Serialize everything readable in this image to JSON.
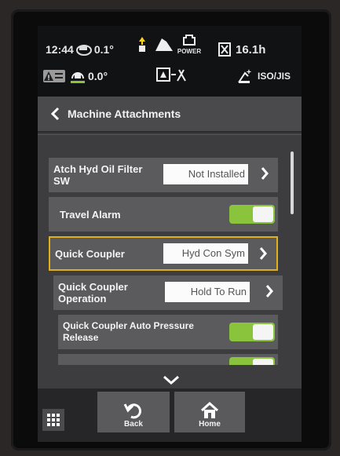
{
  "status": {
    "time": "12:44",
    "pitch": "0.1°",
    "roll": "0.0°",
    "power_label": "POWER",
    "hours": "16.1h",
    "pattern": "ISO/JIS"
  },
  "header": {
    "title": "Machine Attachments"
  },
  "settings": [
    {
      "label": "Atch Hyd Oil Filter SW",
      "value": "Not Installed"
    },
    {
      "label": "Travel Alarm"
    },
    {
      "label": "Quick Coupler",
      "value": "Hyd Con Sym"
    },
    {
      "label": "Quick Coupler Operation",
      "value": "Hold To Run"
    },
    {
      "label": "Quick Coupler Auto Pressure Release"
    }
  ],
  "footer": {
    "back_label": "Back",
    "home_label": "Home"
  },
  "colors": {
    "toggle_on": "#8ac33c",
    "selection": "#e0b01b"
  },
  "icons": [
    "tilt-icon",
    "fuel-icon",
    "power-mode-icon",
    "hourglass-icon",
    "warning-message-icon",
    "roll-icon",
    "work-mode-icon",
    "pattern-icon",
    "menu-grid-icon",
    "back-icon",
    "home-icon",
    "chevron-right-icon",
    "chevron-down-icon"
  ]
}
